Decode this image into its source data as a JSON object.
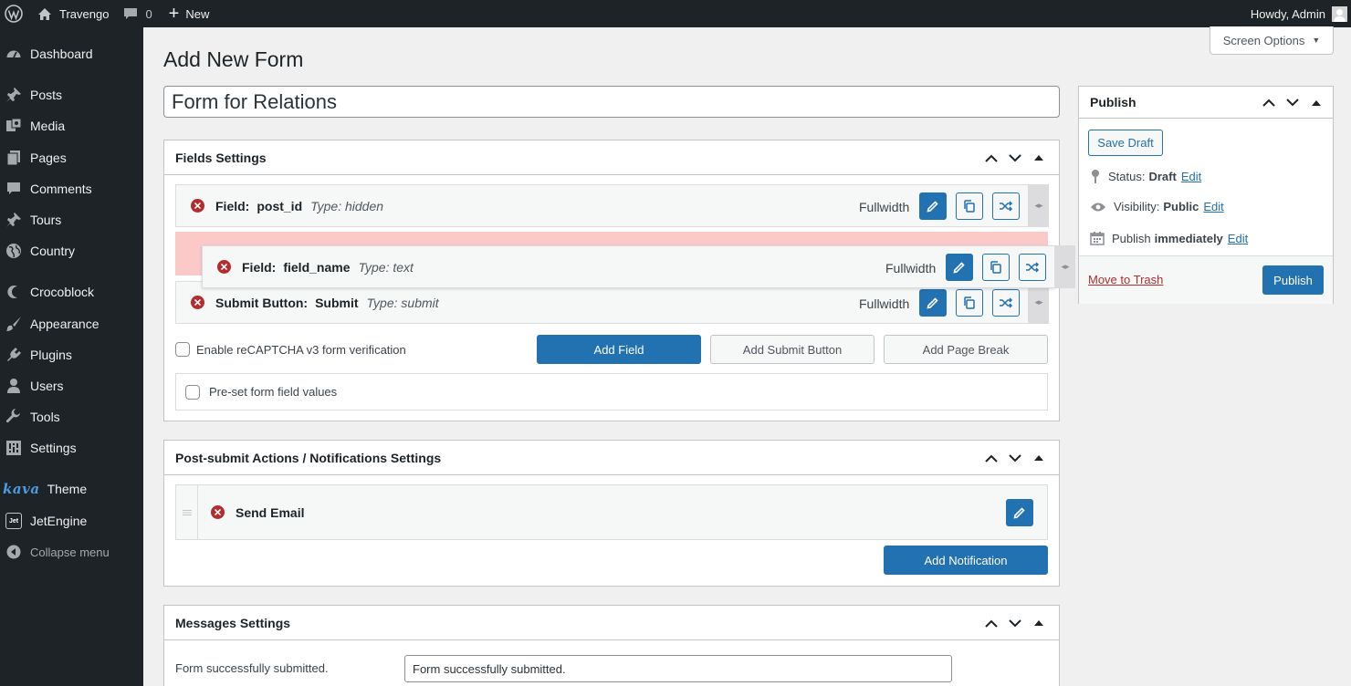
{
  "adminbar": {
    "site_name": "Travengo",
    "comments_count": "0",
    "new_label": "New",
    "howdy": "Howdy, Admin"
  },
  "sidebar": {
    "items": [
      {
        "label": "Dashboard",
        "icon": "dashboard-icon"
      },
      {
        "label": "Posts",
        "icon": "pin-icon"
      },
      {
        "label": "Media",
        "icon": "media-icon"
      },
      {
        "label": "Pages",
        "icon": "pages-icon"
      },
      {
        "label": "Comments",
        "icon": "comments-icon"
      },
      {
        "label": "Tours",
        "icon": "pin-icon"
      },
      {
        "label": "Country",
        "icon": "globe-icon"
      },
      {
        "label": "Crocoblock",
        "icon": "crocoblock-icon"
      },
      {
        "label": "Appearance",
        "icon": "brush-icon"
      },
      {
        "label": "Plugins",
        "icon": "plug-icon"
      },
      {
        "label": "Users",
        "icon": "users-icon"
      },
      {
        "label": "Tools",
        "icon": "wrench-icon"
      },
      {
        "label": "Settings",
        "icon": "settings-icon"
      },
      {
        "label": "Theme",
        "icon": "kava-logo",
        "prefix": "kava"
      },
      {
        "label": "JetEngine",
        "icon": "jetengine-icon",
        "prefix": "Jet"
      },
      {
        "label": "Collapse menu",
        "icon": "collapse-icon"
      }
    ]
  },
  "screen_options": {
    "label": "Screen Options"
  },
  "page": {
    "title": "Add New Form",
    "form_title": "Form for Relations"
  },
  "fields_settings": {
    "title": "Fields Settings",
    "fields": [
      {
        "label": "Field:",
        "name": "post_id",
        "type": "Type: hidden",
        "width": "Fullwidth"
      },
      {
        "label": "Field:",
        "name": "field_name",
        "type": "Type: text",
        "width": "Fullwidth"
      },
      {
        "label": "Submit Button:",
        "name": "Submit",
        "type": "Type: submit",
        "width": "Fullwidth"
      }
    ],
    "recaptcha_label": "Enable reCAPTCHA v3 form verification",
    "add_field": "Add Field",
    "add_submit": "Add Submit Button",
    "add_page_break": "Add Page Break",
    "preset_label": "Pre-set form field values"
  },
  "notifications": {
    "title": "Post-submit Actions / Notifications Settings",
    "items": [
      {
        "label": "Send Email"
      }
    ],
    "add_label": "Add Notification"
  },
  "messages": {
    "title": "Messages Settings",
    "label": "Form successfully submitted.",
    "value": "Form successfully submitted."
  },
  "publish": {
    "title": "Publish",
    "save_draft": "Save Draft",
    "status_label": "Status:",
    "status_value": "Draft",
    "visibility_label": "Visibility:",
    "visibility_value": "Public",
    "publish_label": "Publish",
    "publish_value": "immediately",
    "edit": "Edit",
    "trash": "Move to Trash",
    "publish_button": "Publish"
  },
  "colors": {
    "admin_bar": "#1d2327",
    "primary": "#2271b1",
    "danger": "#b32d2e",
    "drop_placeholder": "#fcc9c9"
  }
}
